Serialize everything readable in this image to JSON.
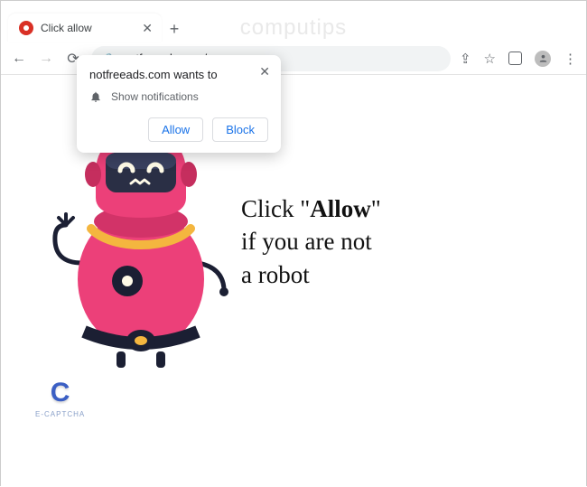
{
  "window": {
    "watermark": "computips"
  },
  "tab": {
    "title": "Click allow"
  },
  "omnibox": {
    "url": "notfreeads.com/"
  },
  "dialog": {
    "host_line": "notfreeads.com wants to",
    "perm_label": "Show notifications",
    "allow": "Allow",
    "block": "Block"
  },
  "page": {
    "prefix": "Click \"",
    "allow_word": "Allow",
    "suffix": "\"",
    "line2": "if you are not",
    "line3": "a robot",
    "captcha_label": "E-CAPTCHA"
  }
}
